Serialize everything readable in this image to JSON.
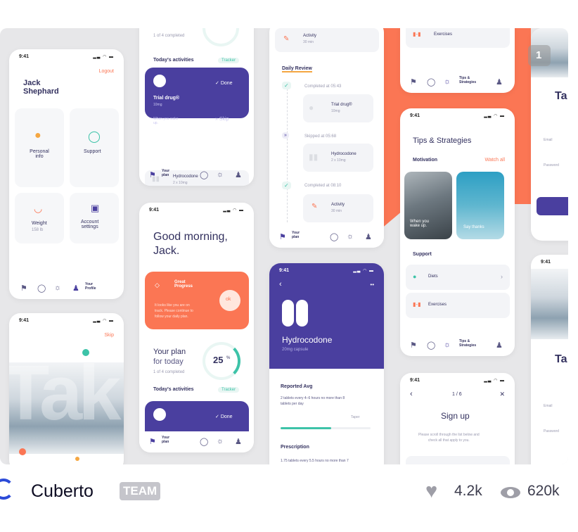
{
  "colors": {
    "purple": "#4a3f9f",
    "orange": "#fb7654",
    "teal": "#3dc3a8"
  },
  "badge": {
    "count": "1"
  },
  "status": {
    "time": "9:41"
  },
  "profile": {
    "logout": "Logout",
    "name_line1": "Jack",
    "name_line2": "Shephard",
    "personal": "Personal\ninfo",
    "support": "Support",
    "weight": "Weight",
    "weight_value": "158 lb",
    "account": "Account\nsettings",
    "your_profile": "Your\nProfile"
  },
  "plan_top": {
    "completed": "1 of 4 completed",
    "today": "Today's activities",
    "tracker": "Tracker",
    "drug": "Trial drug®",
    "dose": "10mg",
    "done": "Done",
    "wake": "When you wake\nup.",
    "skip": "Skip",
    "hydro": "Hydrocodone",
    "hydro_dose": "2 x 10mg",
    "your_plan": "Your\nplan"
  },
  "morning": {
    "greeting1": "Good morning,",
    "greeting2": "Jack.",
    "great": "Great\nProgress",
    "body": "It looks like you are on\ntrack. Please continue to\nfollow your daily plan.",
    "ok": "ok",
    "plan1": "Your plan",
    "plan2": "for today",
    "completed": "1 of 4 completed",
    "percent": "25",
    "percent_sign": "%",
    "today": "Today's activities",
    "tracker": "Tracker",
    "done": "Done",
    "your_plan": "Your\nplan"
  },
  "skip_screen": {
    "skip": "Skip",
    "letters": "Tak"
  },
  "review": {
    "activity": "Activity",
    "activity_time": "30 min",
    "daily": "Daily Review",
    "c1": "Completed at 05:43",
    "trial": "Trial drug®",
    "trial_dose": "10mg",
    "s1": "Skipped at 05:68",
    "hydro": "Hydrocodone",
    "hydro_dose": "2 x 10mg",
    "c2": "Completed at 08:10",
    "activity2": "Activity",
    "activity2_time": "30 min",
    "your_plan": "Your\nplan"
  },
  "hydro_screen": {
    "title": "Hydrocodone",
    "subtitle": "20mg capsule",
    "reported": "Reported Avg",
    "reported_text": "2 tablets every 4–6 hours no more than 8\ntablets per day",
    "taper": "Taper",
    "prescription": "Prescription",
    "prescription_text": "1.75 tablets every 5.5 hours no more than 7"
  },
  "tips_top": {
    "exercises": "Exercises",
    "tips": "Tips &\nStrategies"
  },
  "tips": {
    "title": "Tips & Strategies",
    "motivation": "Motivation",
    "watch_all": "Watch all",
    "card1": "When you\nwake up.",
    "card2": "Say thanks",
    "support": "Support",
    "diets": "Diets",
    "exercises": "Exercises",
    "tips": "Tips &\nStrategies"
  },
  "signup": {
    "progress": "1 / 6",
    "title": "Sign up",
    "body": "Please scroll through the list below and\ncheck all that apply to you."
  },
  "login_edge": {
    "heading": "Ta",
    "email": "Email",
    "password": "Password"
  },
  "footer": {
    "team_name": "Cuberto",
    "team_badge": "TEAM",
    "likes": "4.2k",
    "views": "620k"
  }
}
